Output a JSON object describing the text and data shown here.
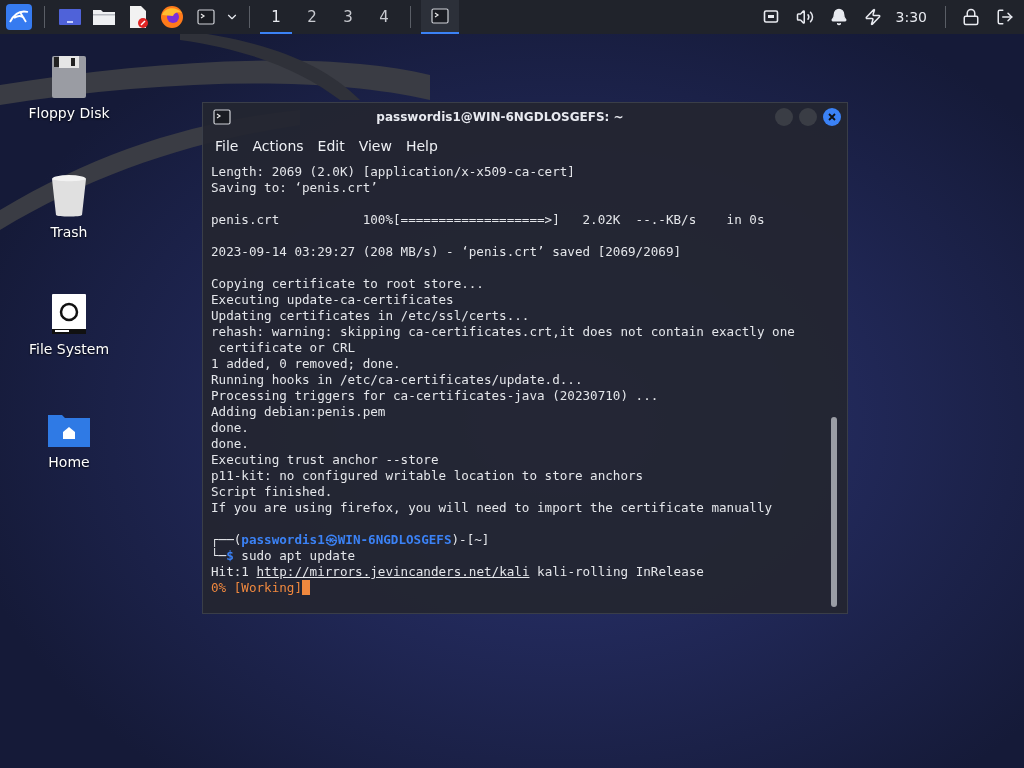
{
  "taskbar": {
    "launchers": [
      {
        "kind": "menu"
      },
      {
        "kind": "desktop"
      },
      {
        "kind": "files"
      },
      {
        "kind": "editor"
      },
      {
        "kind": "browser"
      },
      {
        "kind": "terminal"
      }
    ],
    "workspaces": [
      {
        "label": "1",
        "selected": true
      },
      {
        "label": "2",
        "selected": false
      },
      {
        "label": "3",
        "selected": false
      },
      {
        "label": "4",
        "selected": false
      }
    ],
    "tasks": [
      {
        "kind": "terminal",
        "selected": true
      }
    ],
    "tray": [
      {
        "kind": "network"
      },
      {
        "kind": "volume"
      },
      {
        "kind": "bell"
      },
      {
        "kind": "power"
      }
    ],
    "clock": "3:30",
    "actions": [
      {
        "kind": "lock"
      },
      {
        "kind": "logout"
      }
    ]
  },
  "desktop_icons": [
    {
      "kind": "floppy",
      "label": "Floppy Disk"
    },
    {
      "kind": "trash",
      "label": "Trash"
    },
    {
      "kind": "drive",
      "label": "File System"
    },
    {
      "kind": "home",
      "label": "Home"
    }
  ],
  "terminal": {
    "title": "passwordis1@WIN-6NGDLOSGEFS: ~",
    "menu": [
      "File",
      "Actions",
      "Edit",
      "View",
      "Help"
    ],
    "lines": [
      {
        "kind": "text",
        "text": "Length: 2069 (2.0K) [application/x-x509-ca-cert]"
      },
      {
        "kind": "text",
        "text": "Saving to: ‘penis.crt’"
      },
      {
        "kind": "blank"
      },
      {
        "kind": "text",
        "text": "penis.crt           100%[===================>]   2.02K  --.-KB/s    in 0s"
      },
      {
        "kind": "blank"
      },
      {
        "kind": "text",
        "text": "2023-09-14 03:29:27 (208 MB/s) - ‘penis.crt’ saved [2069/2069]"
      },
      {
        "kind": "blank"
      },
      {
        "kind": "text",
        "text": "Copying certificate to root store..."
      },
      {
        "kind": "text",
        "text": "Executing update-ca-certificates"
      },
      {
        "kind": "text",
        "text": "Updating certificates in /etc/ssl/certs..."
      },
      {
        "kind": "text",
        "text": "rehash: warning: skipping ca-certificates.crt,it does not contain exactly one"
      },
      {
        "kind": "text",
        "text": " certificate or CRL"
      },
      {
        "kind": "text",
        "text": "1 added, 0 removed; done."
      },
      {
        "kind": "text",
        "text": "Running hooks in /etc/ca-certificates/update.d..."
      },
      {
        "kind": "text",
        "text": "Processing triggers for ca-certificates-java (20230710) ..."
      },
      {
        "kind": "text",
        "text": "Adding debian:penis.pem"
      },
      {
        "kind": "text",
        "text": "done."
      },
      {
        "kind": "text",
        "text": "done."
      },
      {
        "kind": "text",
        "text": "Executing trust anchor --store"
      },
      {
        "kind": "text",
        "text": "p11-kit: no configured writable location to store anchors"
      },
      {
        "kind": "text",
        "text": "Script finished."
      },
      {
        "kind": "text",
        "text": "If you are using firefox, you will need to import the certificate manually"
      },
      {
        "kind": "blank"
      },
      {
        "kind": "prompt",
        "open": "┌──(",
        "user": "passwordis1",
        "at": "㉿",
        "host": "WIN-6NGDLOSGEFS",
        "mid": ")-[",
        "dir": "~",
        "close": "]"
      },
      {
        "kind": "command",
        "corner": "└─",
        "symbol": "$",
        "command": "sudo apt update"
      },
      {
        "kind": "link",
        "prefix": "Hit:1",
        "url": "http://mirrors.jevincanders.net/kali",
        "suffix": "kali-rolling InRelease"
      },
      {
        "kind": "working",
        "text": "0% [Working]"
      }
    ]
  }
}
